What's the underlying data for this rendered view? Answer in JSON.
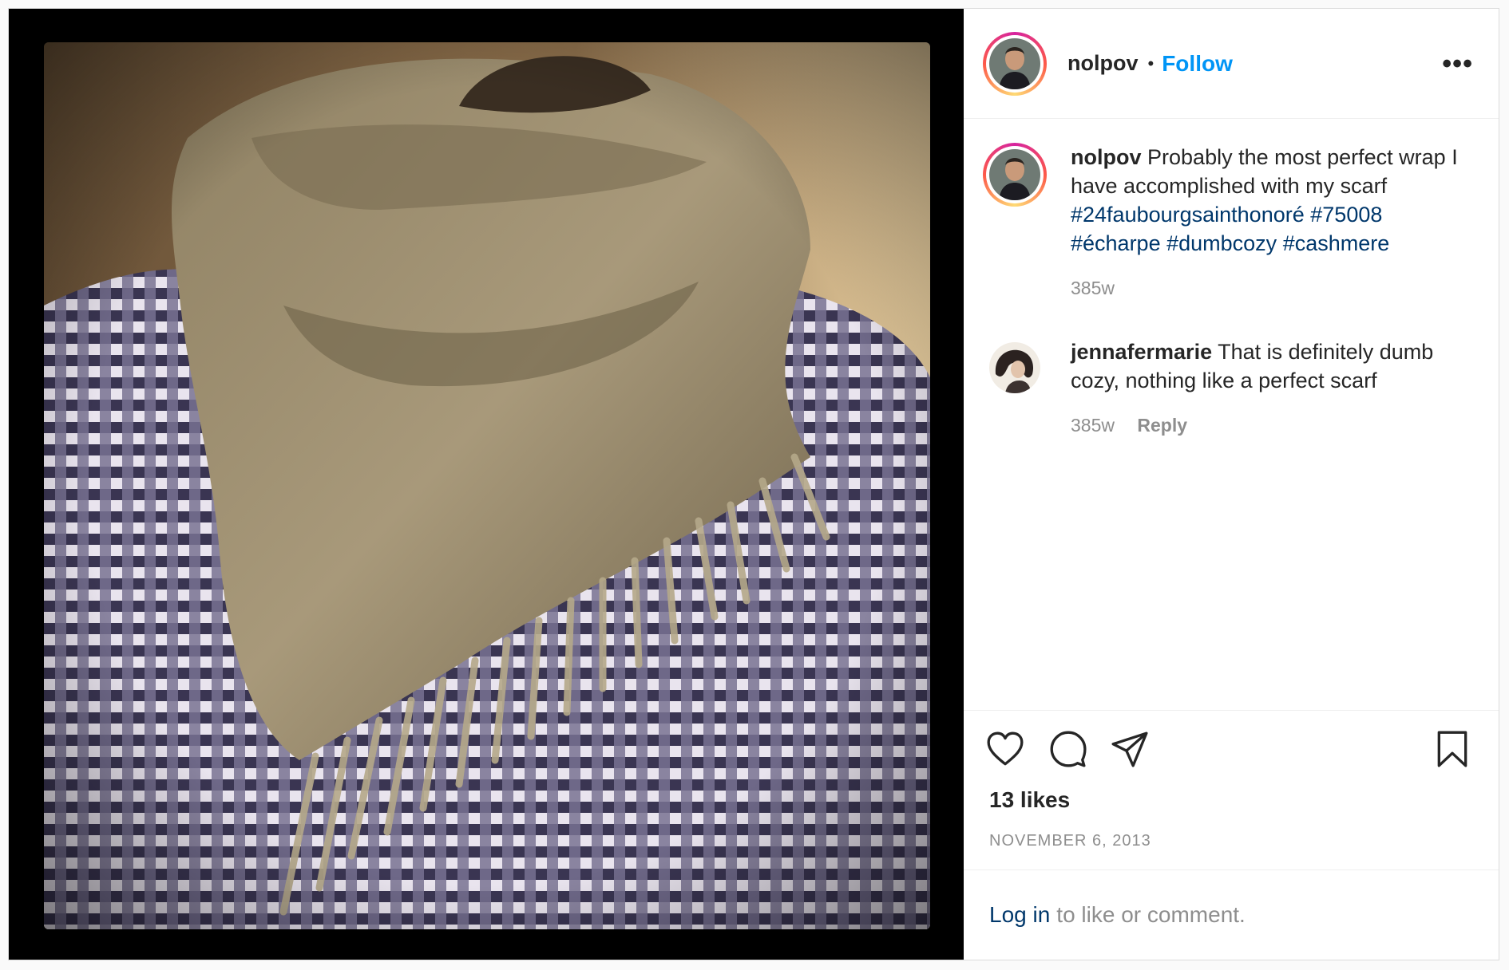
{
  "post": {
    "username": "nolpov",
    "separator": "•",
    "follow_label": "Follow",
    "more_icon": "more-horizontal-icon"
  },
  "caption": {
    "username": "nolpov",
    "text": "Probably the most perfect wrap I have accomplished with my scarf",
    "hashtags": [
      "#24faubourgsainthonoré",
      "#75008",
      "#écharpe",
      "#dumbcozy",
      "#cashmere"
    ],
    "time": "385w"
  },
  "comments": [
    {
      "username": "jennafermarie",
      "text": "That is definitely dumb cozy, nothing like a perfect scarf",
      "time": "385w",
      "reply_label": "Reply"
    }
  ],
  "actions": {
    "like_icon": "heart-icon",
    "comment_icon": "comment-bubble-icon",
    "share_icon": "paper-plane-icon",
    "save_icon": "bookmark-icon"
  },
  "likes": "13 likes",
  "date": "NOVEMBER 6, 2013",
  "login": {
    "link_label": "Log in",
    "rest_label": "to like or comment."
  },
  "colors": {
    "link_blue": "#0095f6",
    "hashtag": "#00376b",
    "meta_gray": "#8e8e8e"
  }
}
